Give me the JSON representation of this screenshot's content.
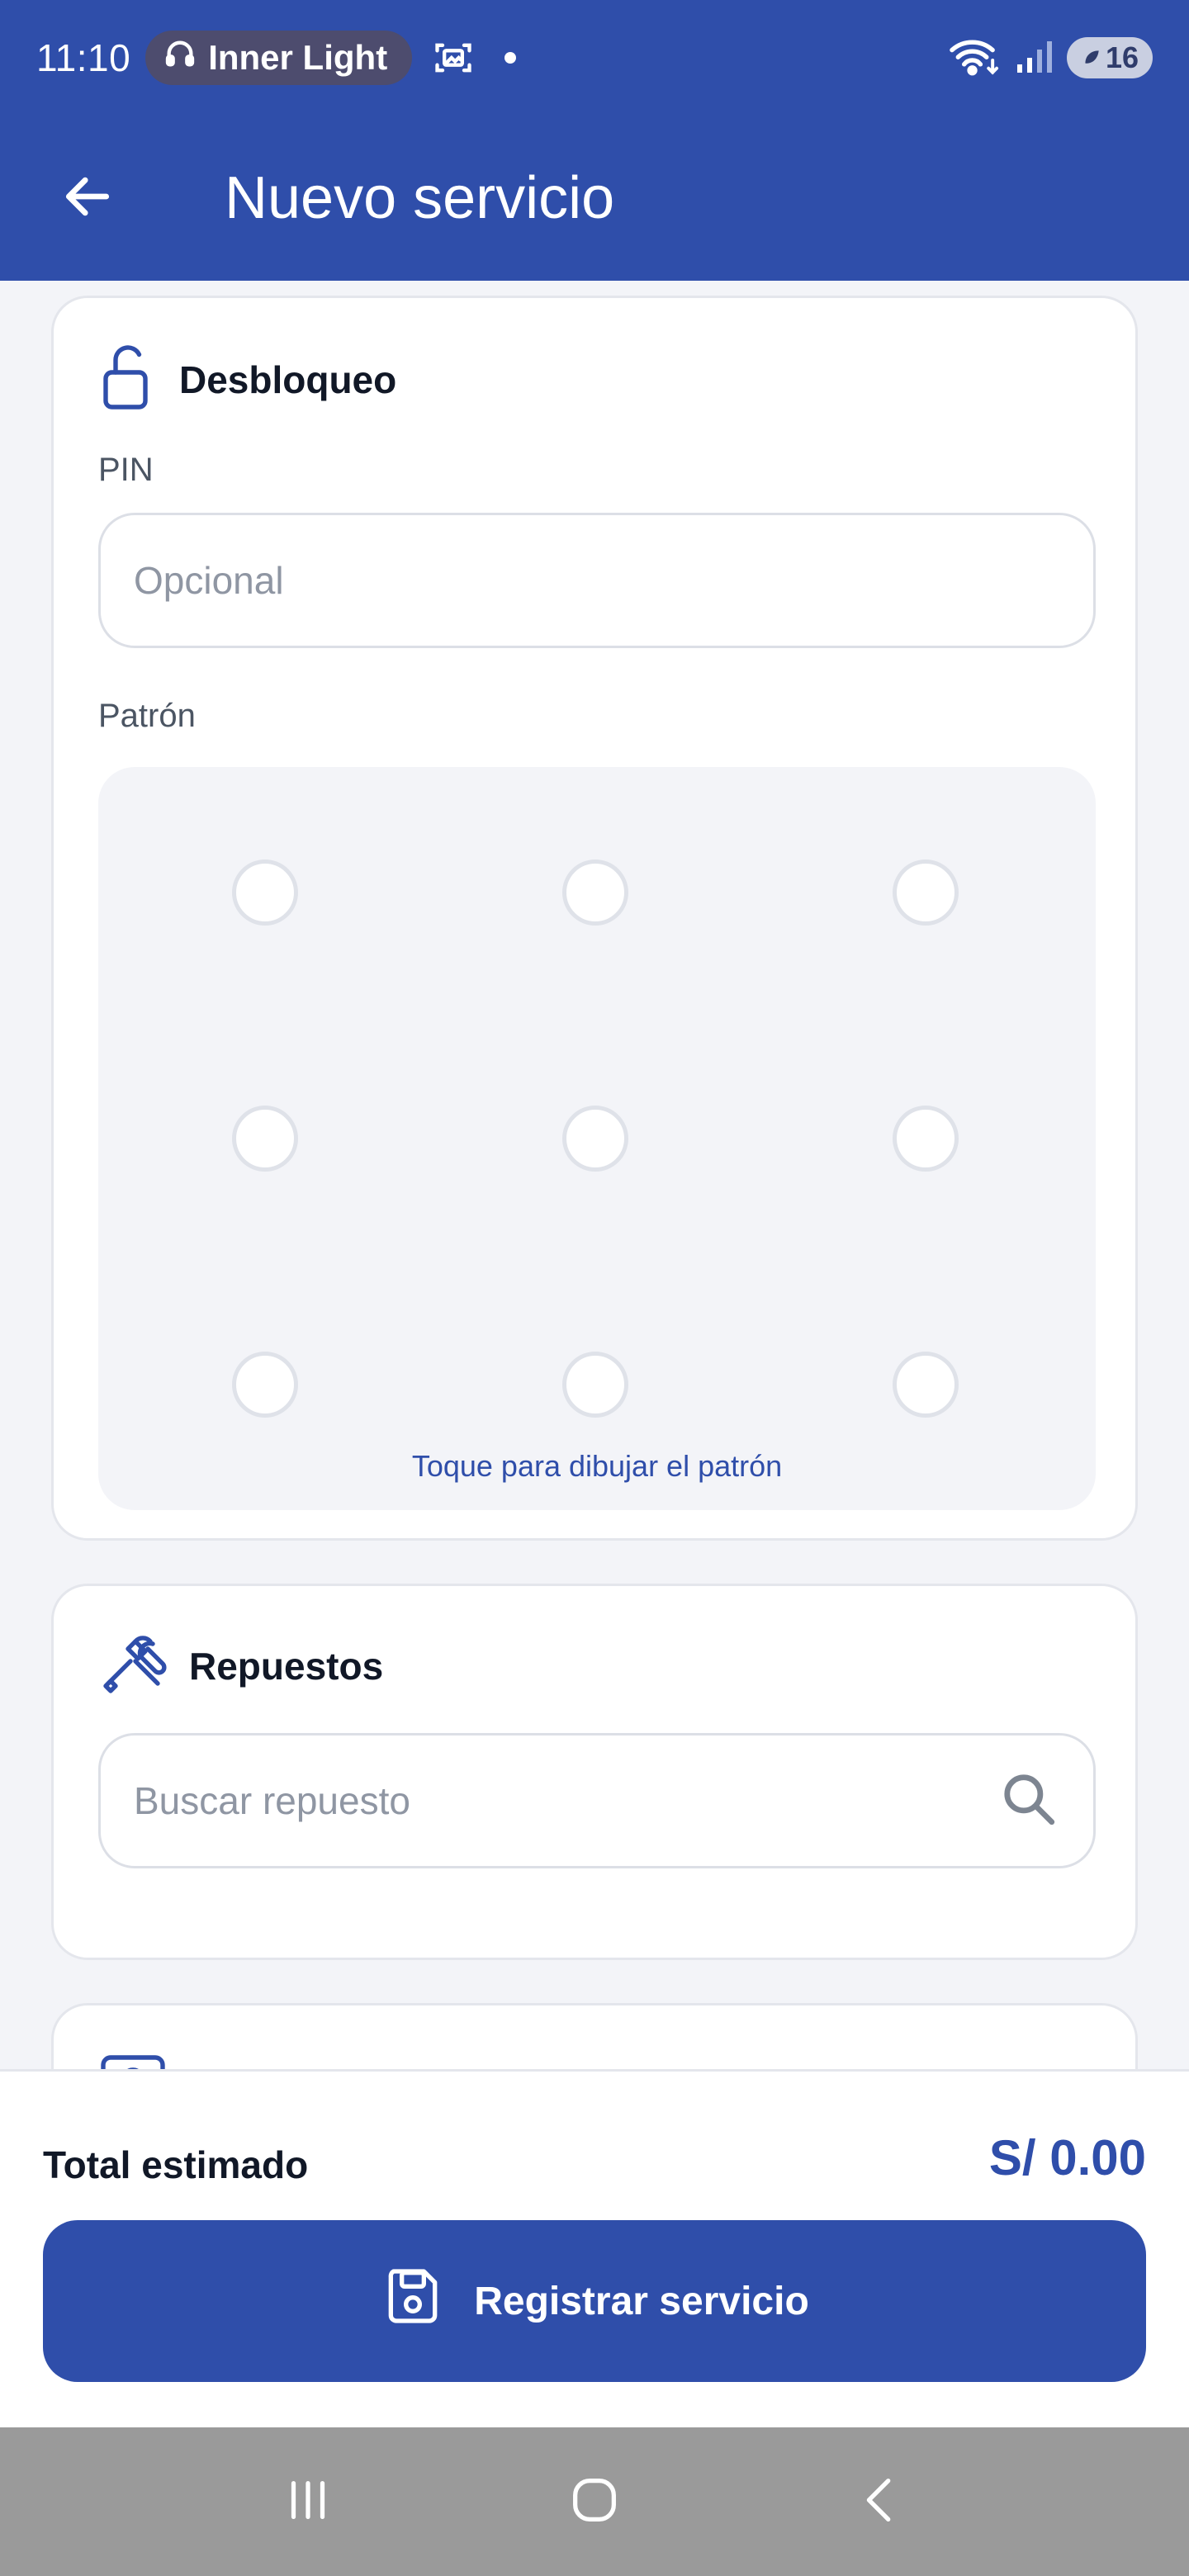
{
  "status_bar": {
    "time": "11:10",
    "media_chip": "Inner Light",
    "battery": "16"
  },
  "app_bar": {
    "title": "Nuevo servicio"
  },
  "unlock_card": {
    "title": "Desbloqueo",
    "pin_label": "PIN",
    "pin_placeholder": "Opcional",
    "pin_value": "",
    "pattern_label": "Patrón",
    "pattern_hint": "Toque para dibujar el patrón"
  },
  "parts_card": {
    "title": "Repuestos",
    "search_placeholder": "Buscar repuesto",
    "search_value": ""
  },
  "footer": {
    "total_label": "Total estimado",
    "total_value": "S/ 0.00",
    "submit_label": "Registrar servicio"
  },
  "colors": {
    "primary": "#2f4eaa",
    "background": "#f3f4f8",
    "card": "#ffffff"
  },
  "icons": {
    "back": "arrow-left-icon",
    "unlock": "unlock-icon",
    "parts": "tools-icon",
    "search": "search-icon",
    "save": "save-icon"
  }
}
